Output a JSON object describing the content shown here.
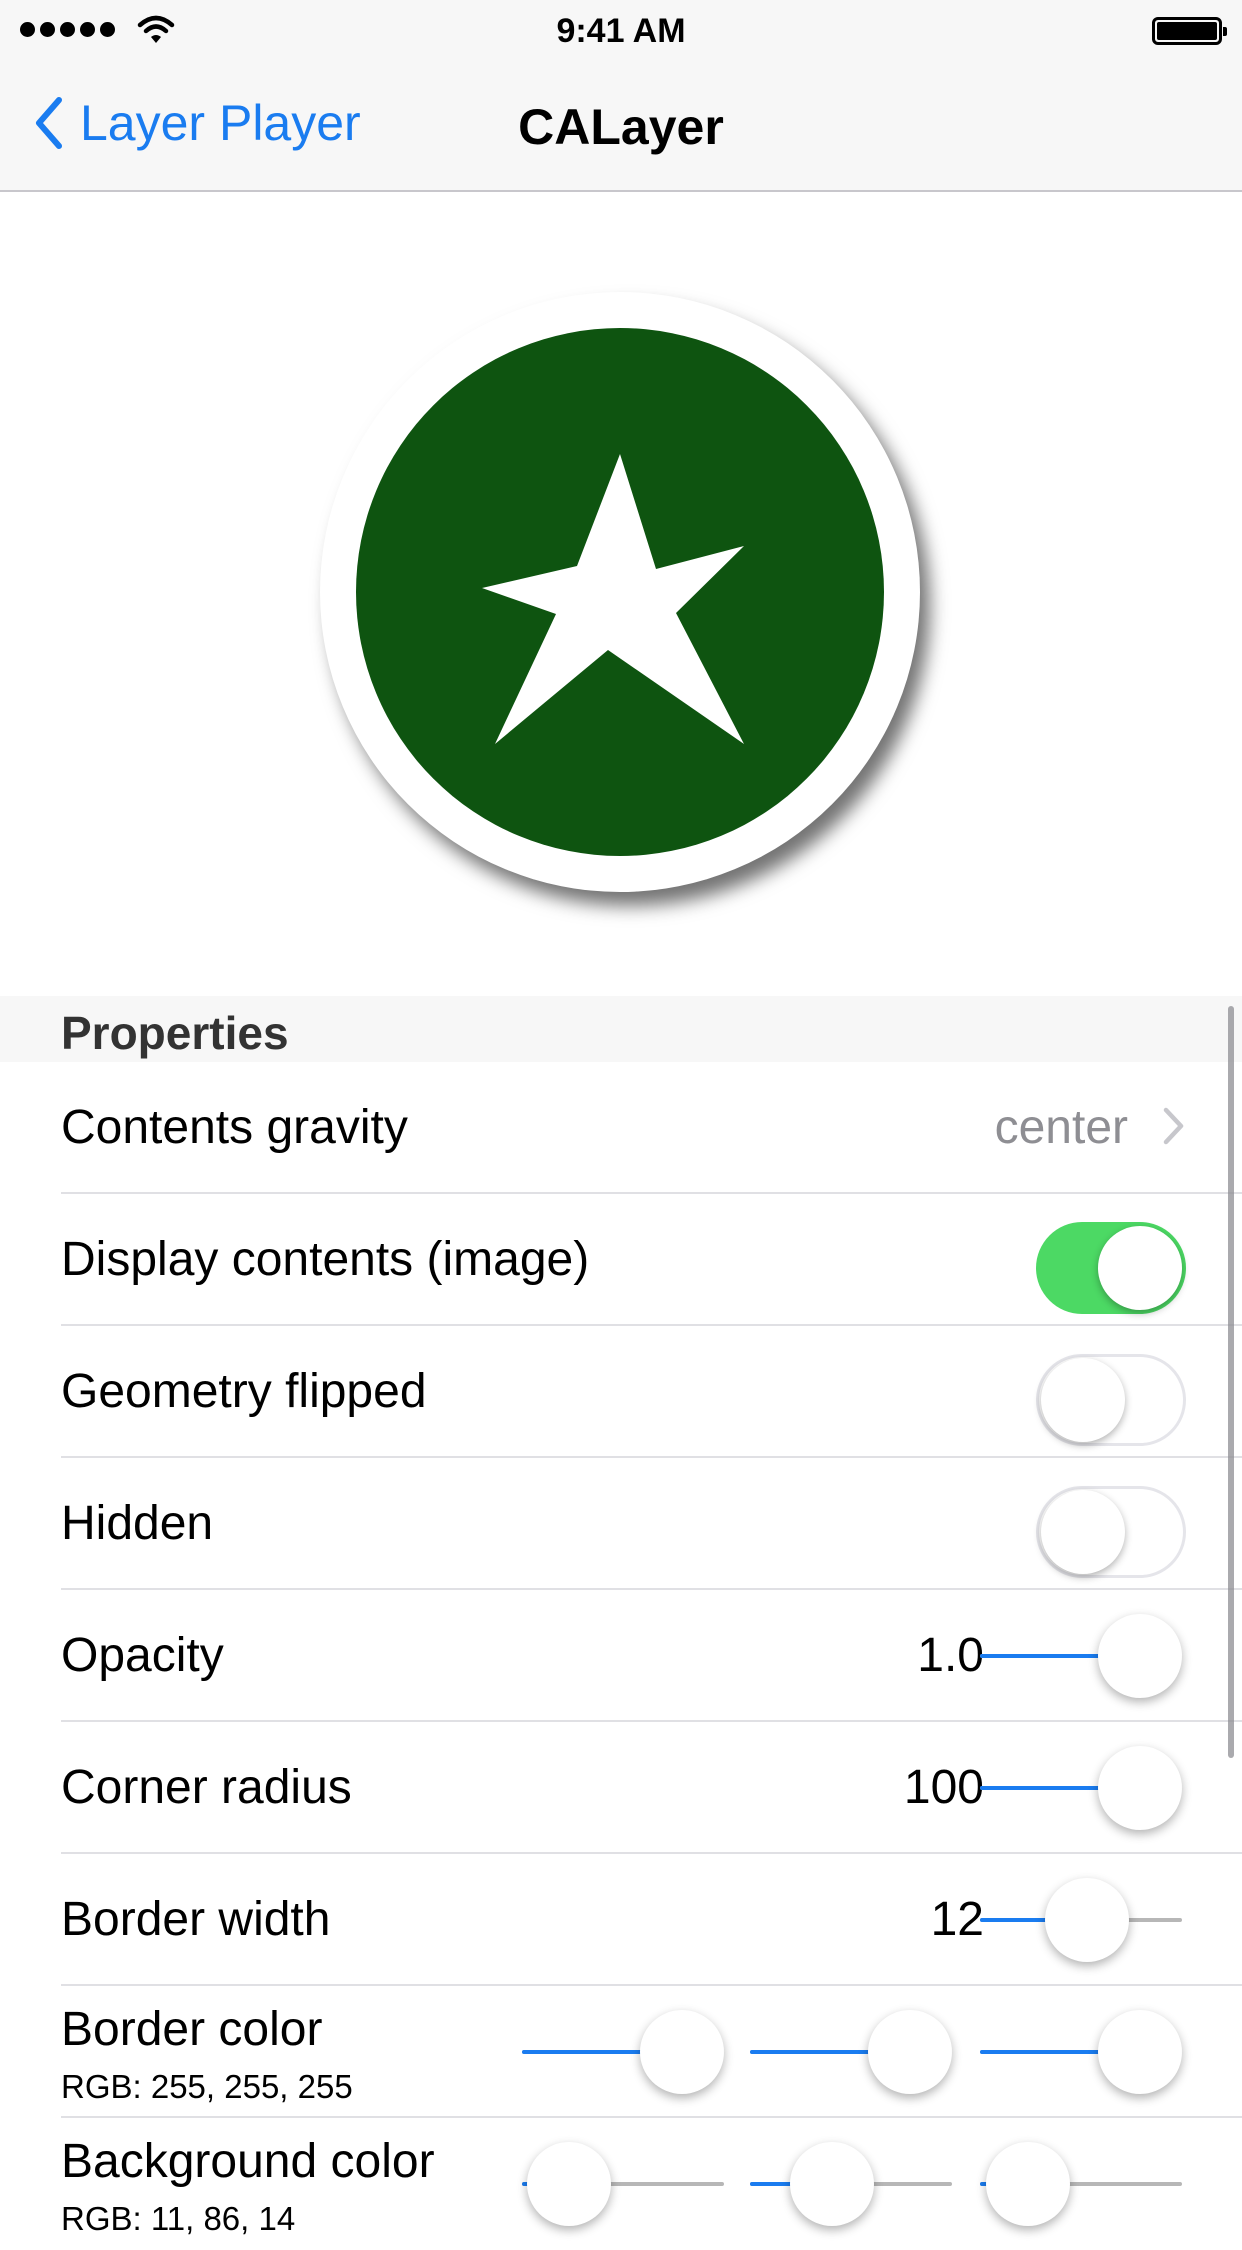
{
  "status_bar": {
    "time": "9:41 AM",
    "signal_icon": "signal-dots-icon",
    "wifi_icon": "wifi-icon",
    "battery_icon": "battery-icon"
  },
  "nav": {
    "back_label": "Layer Player",
    "title": "CALayer"
  },
  "preview": {
    "fill_color": "#0e5410",
    "border_color": "#ffffff",
    "icon": "star-icon"
  },
  "section": {
    "title": "Properties"
  },
  "rows": {
    "contents_gravity": {
      "label": "Contents gravity",
      "value": "center"
    },
    "display_contents": {
      "label": "Display contents (image)",
      "on": true
    },
    "geometry_flipped": {
      "label": "Geometry flipped",
      "on": false
    },
    "hidden": {
      "label": "Hidden",
      "on": false
    },
    "opacity": {
      "label": "Opacity",
      "value": "1.0",
      "fraction": 1.0
    },
    "corner_radius": {
      "label": "Corner radius",
      "value": "100",
      "fraction": 1.0
    },
    "border_width": {
      "label": "Border width",
      "value": "12",
      "fraction": 0.55
    },
    "border_color": {
      "label": "Border color",
      "sublabel": "RGB: 255, 255, 255",
      "fractions": [
        1.0,
        1.0,
        1.0
      ]
    },
    "background_color": {
      "label": "Background color",
      "sublabel": "RGB: 11, 86, 14",
      "fractions": [
        0.04,
        0.34,
        0.05
      ]
    }
  },
  "colors": {
    "accent": "#1a7cf0",
    "switch_on": "#4cd964",
    "detail_gray": "#8e8e93"
  }
}
